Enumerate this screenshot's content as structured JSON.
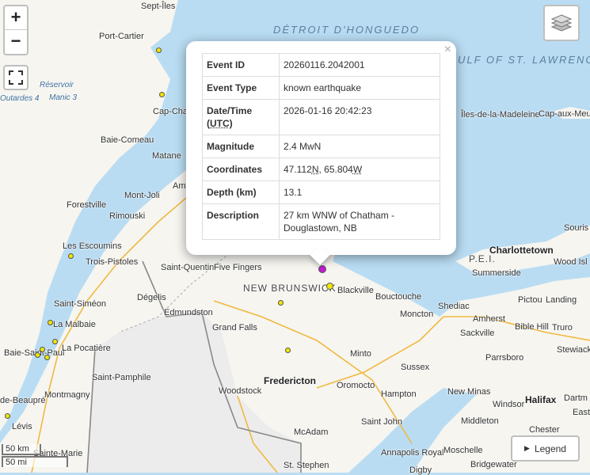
{
  "controls": {
    "zoom_in": "+",
    "zoom_out": "−",
    "legend": "Legend",
    "scale_km": "50 km",
    "scale_mi": "50 mi"
  },
  "icons": [
    "fullscreen-icon",
    "layers-icon",
    "play-triangle-icon",
    "close-icon"
  ],
  "colors": {
    "water": "#b9dcf2",
    "land": "#f6f5f0",
    "us_land": "#ececec",
    "selected_event": "#c020d0",
    "event": "#f2e600"
  },
  "popup": {
    "close": "×",
    "rows": [
      {
        "key": "Event ID",
        "value": "20260116.2042001"
      },
      {
        "key": "Event Type",
        "value": "known earthquake"
      },
      {
        "key_a": "Date/Time",
        "key_b": "UTC",
        "value": "2026-01-16 20:42:23"
      },
      {
        "key": "Magnitude",
        "value": "2.4 MwN"
      },
      {
        "key": "Coordinates",
        "lat": "47.112",
        "lat_dir": "N",
        "lon": "65.804",
        "lon_dir": "W"
      },
      {
        "key": "Depth (km)",
        "value": "13.1"
      },
      {
        "key": "Description",
        "value": "27 km WNW of Chatham - Douglastown, NB"
      }
    ]
  },
  "labels": {
    "sept_iles": "Sept-Îles",
    "port_cartier": "Port-Cartier",
    "detroit": "DÉTROIT D'HONGUEDO",
    "gulf": "ULF OF ST. LAWRENCE",
    "reservoir": "Réservoir",
    "outardes": "Outardes 4",
    "manic": "Manic 3",
    "cap_chat": "Cap-Cha",
    "baie_comeau": "Baie-Comeau",
    "matane": "Matane",
    "amqui": "Am",
    "mont_joli": "Mont-Joli",
    "forestville": "Forestville",
    "rimouski": "Rimouski",
    "les_escoumins": "Les Escoumins",
    "trois_pistoles": "Trois-Pistoles",
    "iles_madeleine": "Îles-de-la-Madeleine",
    "cap_aux_meules": "Cap-aux-Meu",
    "saint_quentin": "Saint-Quentin",
    "five_fingers": "Five Fingers",
    "new_brunswick": "NEW BRUNSWICK",
    "blackville": "Blackville",
    "bouctouche": "Bouctouche",
    "charlottetown": "Charlottetown",
    "pei": "P.E.I.",
    "summerside": "Summerside",
    "wood_isl": "Wood Isl",
    "souris": "Souris",
    "saint_simeon": "Saint-Siméon",
    "degelis": "Dégelis",
    "edmundston": "Edmundston",
    "la_malbaie": "La Malbaie",
    "shediac": "Shediac",
    "pictou": "Pictou",
    "landing": "Landing",
    "grand_falls": "Grand Falls",
    "moncton": "Moncton",
    "amherst": "Amherst",
    "bible_hill": "Bible Hill",
    "truro": "Truro",
    "baie_saint_paul": "Baie-Saint-Paul",
    "la_pocatiere": "La Pocatière",
    "sackville": "Sackville",
    "stewiack": "Stewiack",
    "minto": "Minto",
    "parrsboro": "Parrsboro",
    "saint_pamphile": "Saint-Pamphile",
    "sussex": "Sussex",
    "fredericton": "Fredericton",
    "oromocto": "Oromocto",
    "beaupre": "de-Beaupré",
    "montmagny": "Montmagny",
    "woodstock": "Woodstock",
    "hampton": "Hampton",
    "new_minas": "New Minas",
    "windsor": "Windsor",
    "halifax": "Halifax",
    "east": "East",
    "dartm": "Dartm",
    "levis": "Lévis",
    "saint_john": "Saint John",
    "middleton": "Middleton",
    "mcadam": "McAdam",
    "chester": "Chester",
    "sainte_marie": "Sainte-Marie",
    "annapolis": "Annapolis Royal",
    "moschelle": "Moschelle",
    "st_stephen": "St. Stephen",
    "bridgewater": "Bridgewater",
    "digby": "Digby"
  }
}
